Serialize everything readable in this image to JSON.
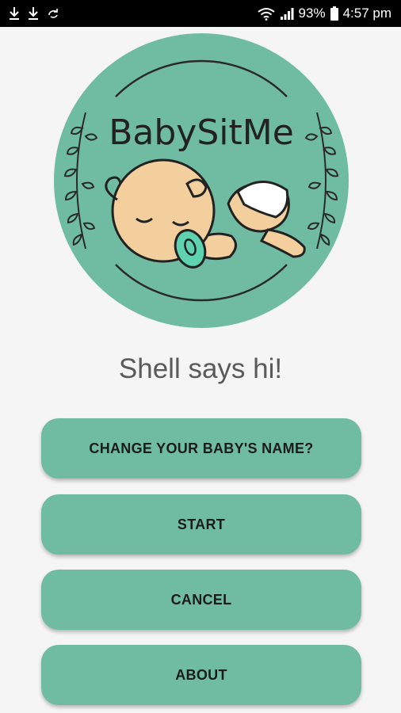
{
  "status_bar": {
    "battery_text": "93%",
    "time": "4:57 pm",
    "left_icons": [
      "download-icon",
      "download-icon",
      "sync-icon"
    ],
    "right_icons": [
      "wifi-icon",
      "signal-icon",
      "battery-icon"
    ]
  },
  "logo": {
    "title": "BabySitMe",
    "badge_color": "#70bca2",
    "skin_color": "#f2cf9c",
    "pacifier_color": "#5fd3b0"
  },
  "greeting": "Shell  says hi!",
  "buttons": {
    "rename": "CHANGE YOUR BABY'S NAME?",
    "start": "START",
    "cancel": "CANCEL",
    "about": "ABOUT"
  },
  "colors": {
    "button": "#70bca2",
    "background": "#f5f5f5",
    "status_bar": "#000000"
  }
}
